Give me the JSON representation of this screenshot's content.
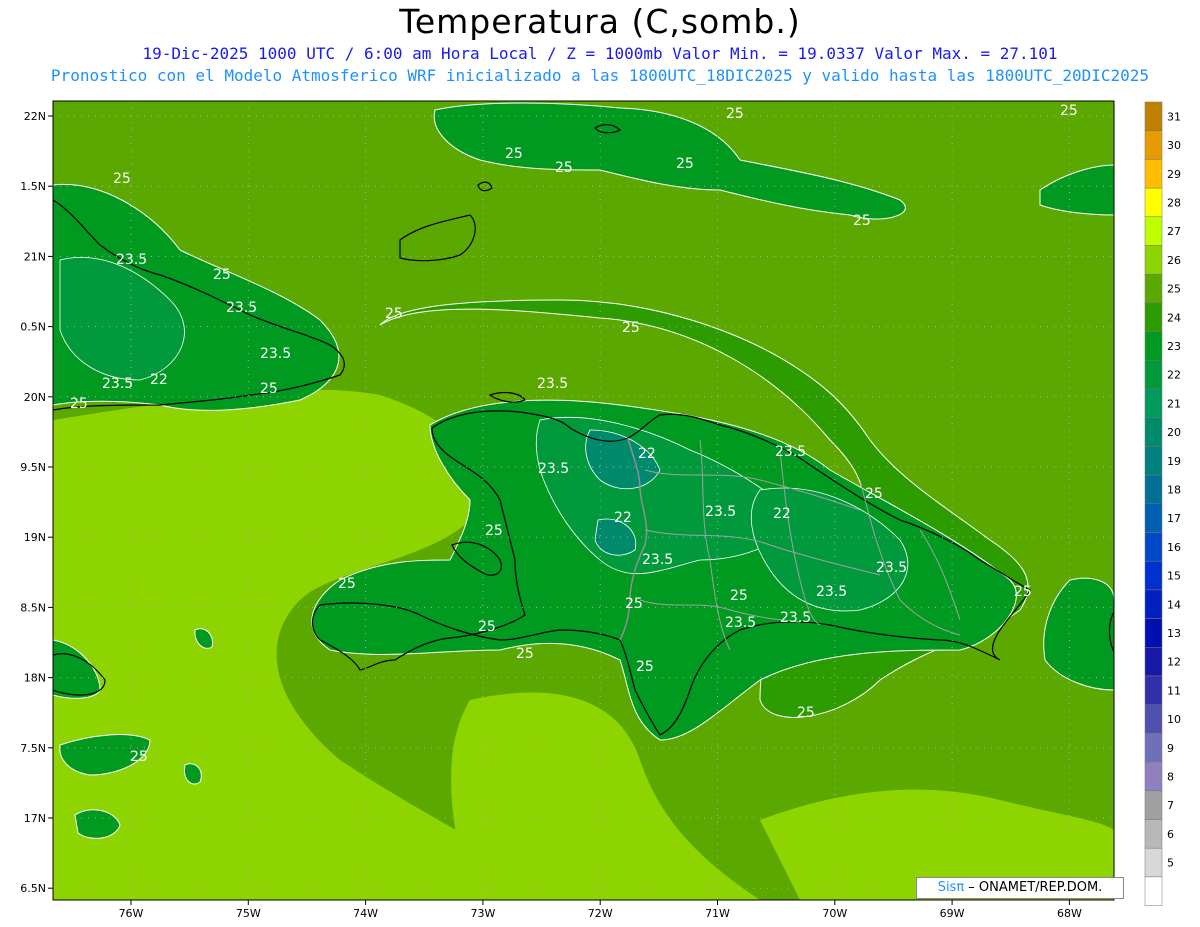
{
  "header": {
    "title": "Temperatura (C,somb.)",
    "line1": "19-Dic-2025  1000 UTC / 6:00 am Hora Local / Z = 1000mb    Valor Min. = 19.0337  Valor Max. = 27.101",
    "line2": "Pronostico con el Modelo Atmosferico WRF inicializado a las 1800UTC_18DIC2025 y valido hasta las  1800UTC_20DIC2025"
  },
  "axes": {
    "lat_labels": [
      "22N",
      "1.5N",
      "21N",
      "0.5N",
      "20N",
      "9.5N",
      "19N",
      "8.5N",
      "18N",
      "7.5N",
      "17N",
      "6.5N"
    ],
    "lon_labels": [
      "76W",
      "75W",
      "74W",
      "73W",
      "72W",
      "71W",
      "70W",
      "69W",
      "68W"
    ]
  },
  "colorbar": {
    "levels": [
      {
        "label": "31",
        "color": "#c08000"
      },
      {
        "label": "30",
        "color": "#e69b00"
      },
      {
        "label": "29",
        "color": "#ffbf00"
      },
      {
        "label": "28",
        "color": "#ffff00"
      },
      {
        "label": "27",
        "color": "#bfff00"
      },
      {
        "label": "26",
        "color": "#8ed400"
      },
      {
        "label": "25",
        "color": "#5aa800"
      },
      {
        "label": "24",
        "color": "#2c9c00"
      },
      {
        "label": "23",
        "color": "#009a20"
      },
      {
        "label": "22",
        "color": "#009a3c"
      },
      {
        "label": "21",
        "color": "#009a5c"
      },
      {
        "label": "20",
        "color": "#008a6c"
      },
      {
        "label": "19",
        "color": "#00807e"
      },
      {
        "label": "18",
        "color": "#007094"
      },
      {
        "label": "17",
        "color": "#005fb0"
      },
      {
        "label": "16",
        "color": "#0048c8"
      },
      {
        "label": "15",
        "color": "#0030d0"
      },
      {
        "label": "14",
        "color": "#0020c0"
      },
      {
        "label": "13",
        "color": "#0010b0"
      },
      {
        "label": "12",
        "color": "#1818a8"
      },
      {
        "label": "11",
        "color": "#3030a8"
      },
      {
        "label": "10",
        "color": "#5050b0"
      },
      {
        "label": "9",
        "color": "#7070b8"
      },
      {
        "label": "8",
        "color": "#9080c0"
      },
      {
        "label": "7",
        "color": "#a0a0a0"
      },
      {
        "label": "6",
        "color": "#b8b8b8"
      },
      {
        "label": "5",
        "color": "#d8d8d8"
      },
      {
        "label": "",
        "color": "#ffffff"
      }
    ]
  },
  "contour_labels": [
    "25",
    "23.5",
    "22"
  ],
  "credit": {
    "sis": "Sisπ",
    "rest": " – ONAMET/REP.DOM."
  },
  "colors": {
    "ocean_bright": "#8ed400",
    "sea_base": "#5aa800",
    "land": "#2c9c00",
    "land_cool": "#009a3c",
    "contour": "#ffffff",
    "border": "#909090",
    "coast": "#000000"
  }
}
